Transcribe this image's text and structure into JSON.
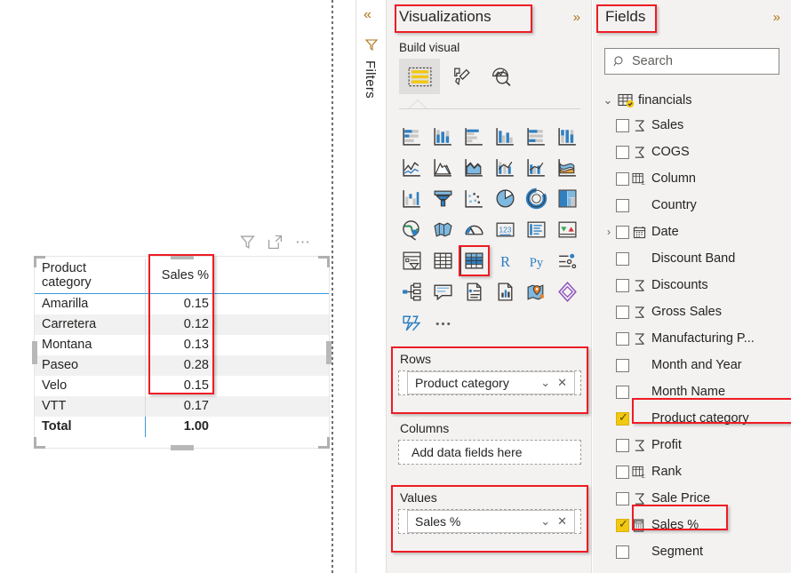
{
  "canvas": {
    "visual_toolbar": [
      {
        "name": "filter-icon",
        "label": "filter"
      },
      {
        "name": "focus-mode-icon",
        "label": "focus mode"
      },
      {
        "name": "more-options-icon",
        "label": "..."
      }
    ],
    "matrix": {
      "columns": [
        "Product category",
        "Sales %"
      ],
      "rows": [
        {
          "category": "Amarilla",
          "value": "0.15"
        },
        {
          "category": "Carretera",
          "value": "0.12"
        },
        {
          "category": "Montana",
          "value": "0.13"
        },
        {
          "category": "Paseo",
          "value": "0.28"
        },
        {
          "category": "Velo",
          "value": "0.15"
        },
        {
          "category": "VTT",
          "value": "0.17"
        }
      ],
      "total_label": "Total",
      "total_value": "1.00"
    }
  },
  "filters_rail": {
    "collapse_label": "«",
    "title": "Filters"
  },
  "visualizations": {
    "title": "Visualizations",
    "expand_label": "»",
    "build_label": "Build visual",
    "modes": [
      {
        "name": "build-visual-mode",
        "selected": true
      },
      {
        "name": "format-visual-mode",
        "selected": false
      },
      {
        "name": "analytics-mode",
        "selected": false
      }
    ],
    "icons": [
      [
        "stacked-bar-chart",
        "stacked-column-chart",
        "clustered-bar-chart",
        "clustered-column-chart",
        "hundred-percent-stacked-bar-chart",
        "hundred-percent-stacked-column-chart"
      ],
      [
        "line-chart",
        "area-chart",
        "stacked-area-chart",
        "line-and-stacked-column-chart",
        "line-and-clustered-column-chart",
        "ribbon-chart"
      ],
      [
        "waterfall-chart",
        "funnel-chart",
        "scatter-chart",
        "pie-chart",
        "donut-chart",
        "treemap-chart"
      ],
      [
        "map-chart",
        "filled-map-chart",
        "gauge-chart",
        "card-visual",
        "multi-row-card",
        "kpi-visual"
      ],
      [
        "slicer-visual",
        "table-visual",
        "matrix-visual",
        "r-script-visual",
        "python-visual",
        "key-influencers-visual"
      ],
      [
        "decomposition-tree-visual",
        "qna-visual",
        "smart-narrative-visual",
        "paginated-report-visual",
        "arcgis-map-visual",
        "powerapps-visual"
      ],
      [
        "power-automate-visual",
        "more-visuals-ellipsis"
      ]
    ],
    "selected_icon": "matrix-visual",
    "wells": [
      {
        "name": "rows",
        "label": "Rows",
        "field": "Product category",
        "placeholder": null,
        "highlighted": true
      },
      {
        "name": "columns",
        "label": "Columns",
        "field": null,
        "placeholder": "Add data fields here",
        "highlighted": false
      },
      {
        "name": "values",
        "label": "Values",
        "field": "Sales %",
        "placeholder": null,
        "highlighted": true
      }
    ],
    "chip_caret": "⌄",
    "chip_remove": "✕"
  },
  "fields": {
    "title": "Fields",
    "expand_label": "»",
    "search": {
      "placeholder": "Search",
      "value": ""
    },
    "table": {
      "name": "financials",
      "expanded": true,
      "expander": "⌄"
    },
    "items": [
      {
        "label": "Sales",
        "icon": "sigma-icon",
        "checked": false,
        "expandable": false
      },
      {
        "label": "COGS",
        "icon": "sigma-icon",
        "checked": false,
        "expandable": false
      },
      {
        "label": "Column",
        "icon": "calculated-column-icon",
        "checked": false,
        "expandable": false
      },
      {
        "label": "Country",
        "icon": "none",
        "checked": false,
        "expandable": false
      },
      {
        "label": "Date",
        "icon": "calendar-icon",
        "checked": false,
        "expandable": true
      },
      {
        "label": "Discount Band",
        "icon": "none",
        "checked": false,
        "expandable": false
      },
      {
        "label": "Discounts",
        "icon": "sigma-icon",
        "checked": false,
        "expandable": false
      },
      {
        "label": "Gross Sales",
        "icon": "sigma-icon",
        "checked": false,
        "expandable": false
      },
      {
        "label": "Manufacturing P...",
        "icon": "sigma-icon",
        "checked": false,
        "expandable": false
      },
      {
        "label": "Month and Year",
        "icon": "none",
        "checked": false,
        "expandable": false
      },
      {
        "label": "Month Name",
        "icon": "none",
        "checked": false,
        "expandable": false
      },
      {
        "label": "Product category",
        "icon": "none",
        "checked": true,
        "expandable": false,
        "highlighted": true
      },
      {
        "label": "Profit",
        "icon": "sigma-icon",
        "checked": false,
        "expandable": false
      },
      {
        "label": "Rank",
        "icon": "calculated-column-icon",
        "checked": false,
        "expandable": false
      },
      {
        "label": "Sale Price",
        "icon": "sigma-icon",
        "checked": false,
        "expandable": false
      },
      {
        "label": "Sales %",
        "icon": "measure-icon",
        "checked": true,
        "expandable": false,
        "highlighted": true
      },
      {
        "label": "Segment",
        "icon": "none",
        "checked": false,
        "expandable": false
      }
    ]
  },
  "colors": {
    "highlight_red": "#ee1c25",
    "accent_yellow": "#f2c811",
    "panel_bg": "#f3f2f1",
    "table_rule_blue": "#3a9ad9",
    "chevron_orange": "#b07219"
  }
}
